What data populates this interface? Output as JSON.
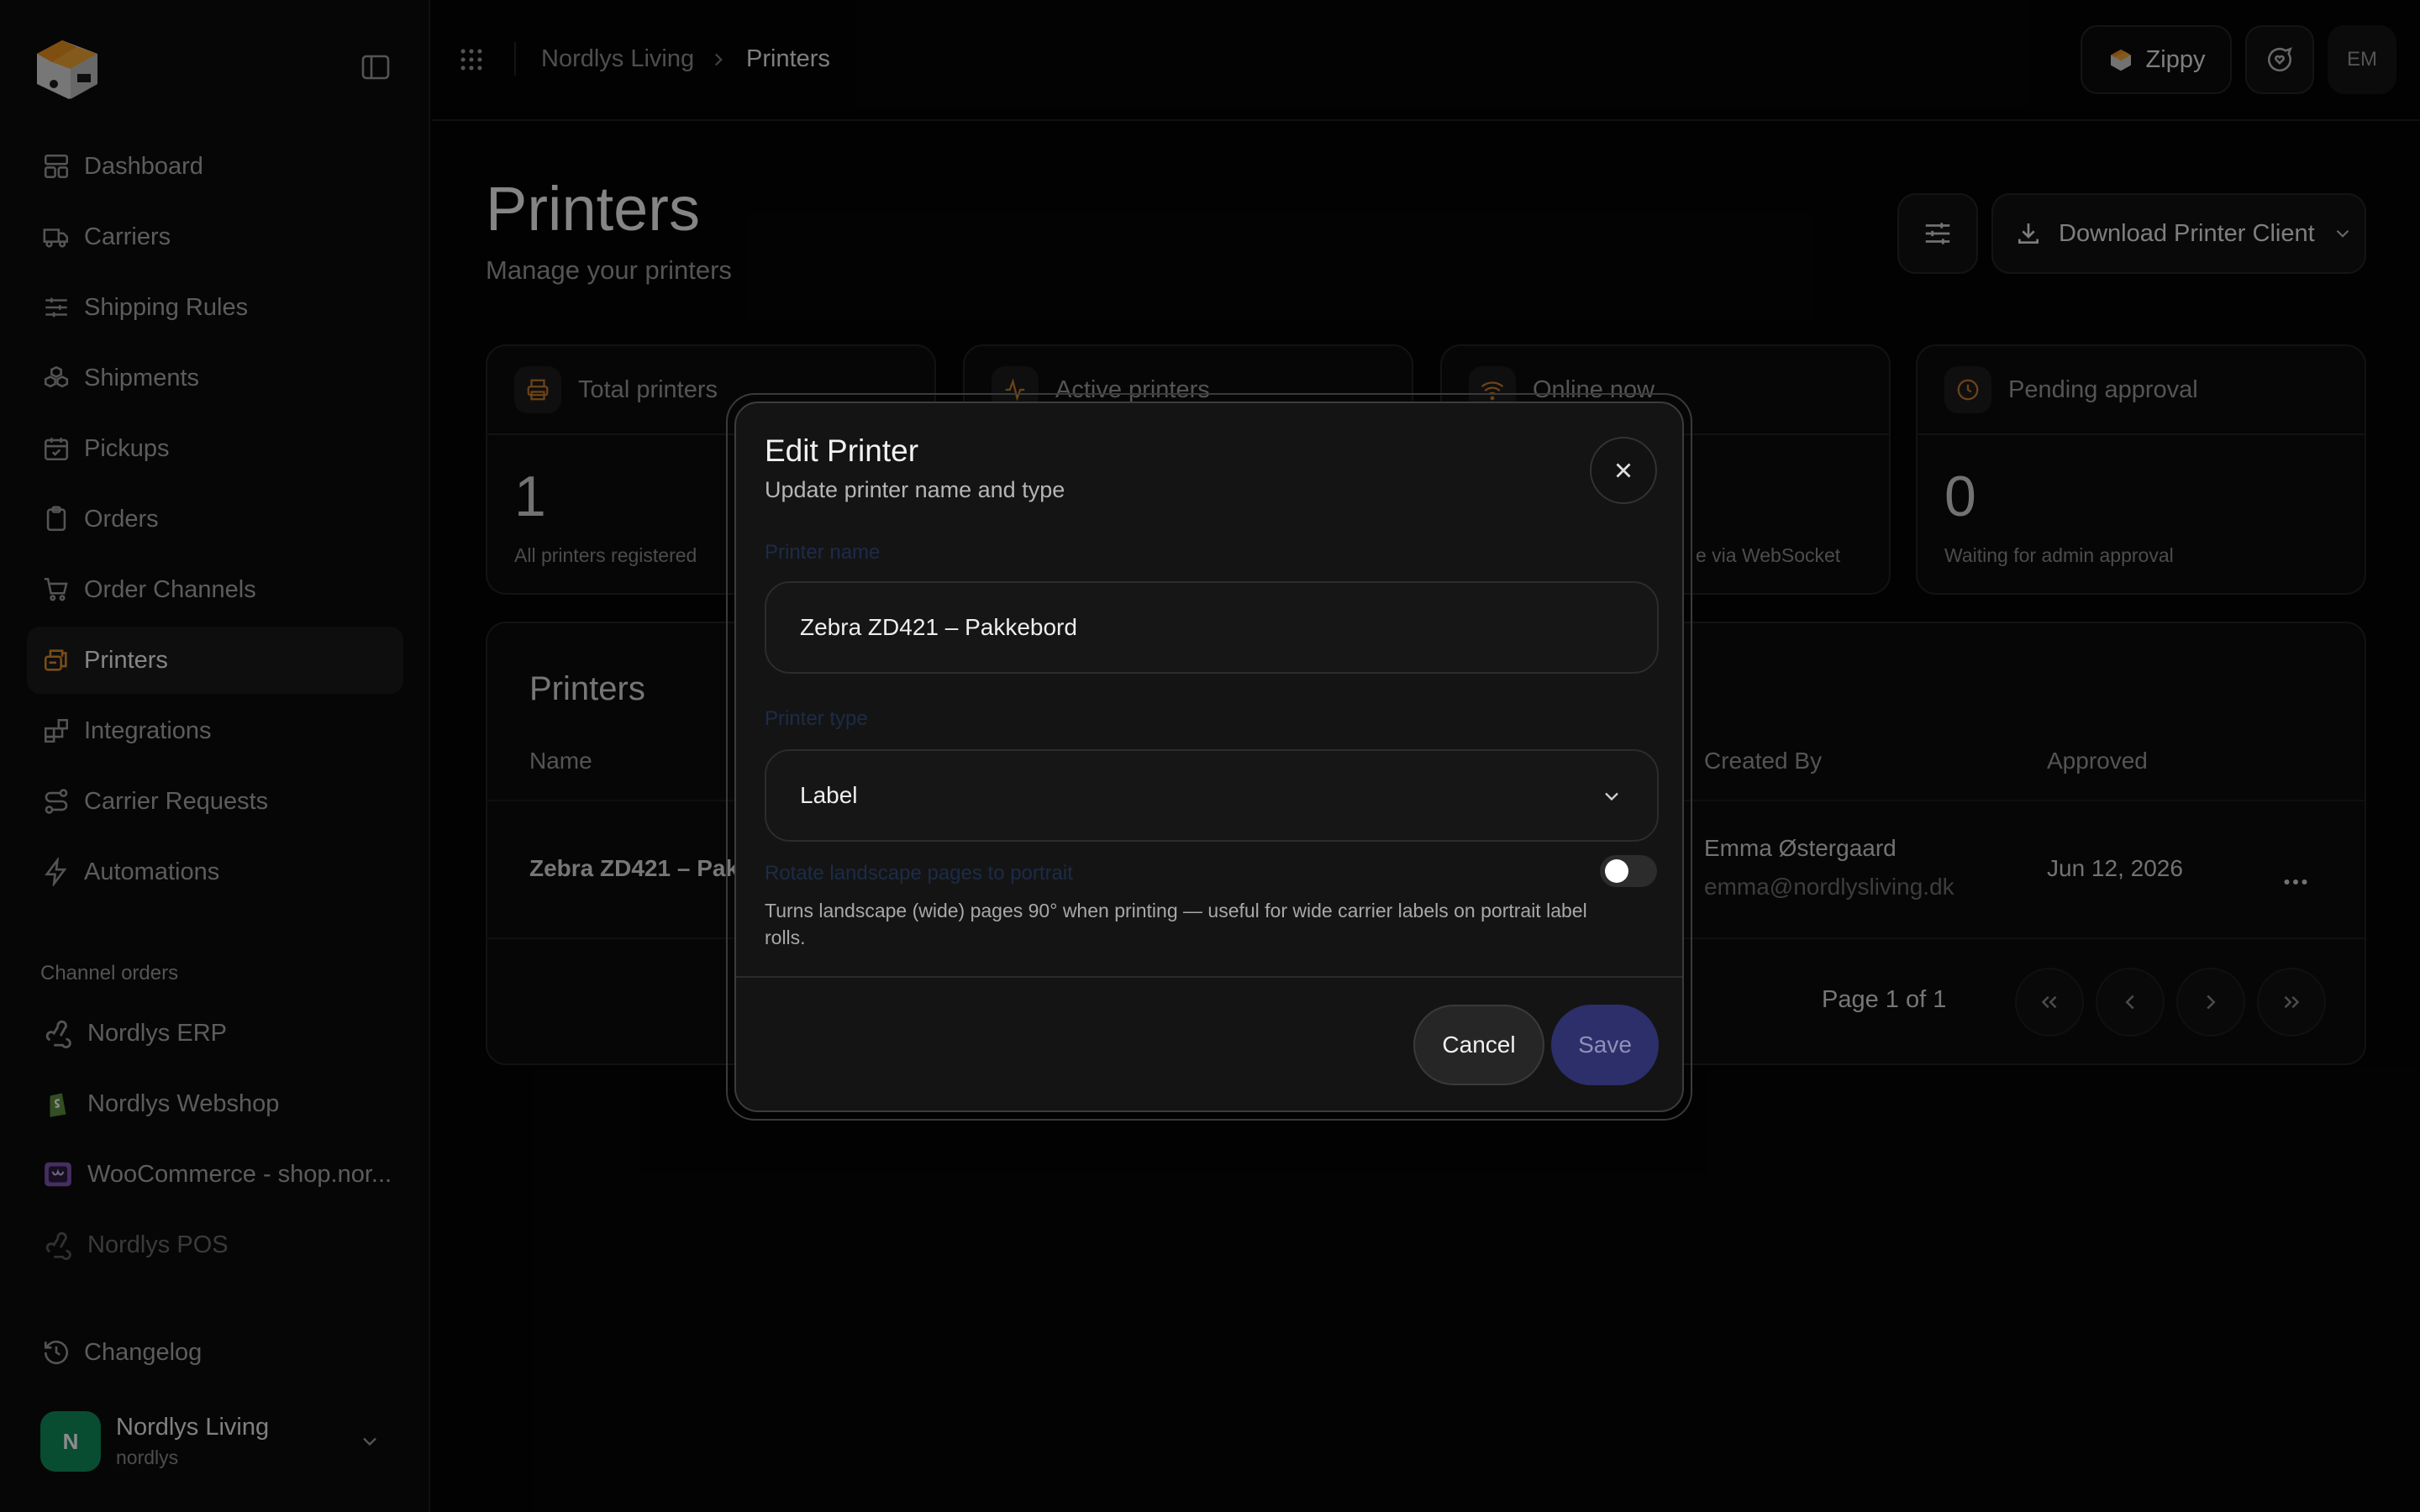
{
  "breadcrumb": {
    "org": "Nordlys Living",
    "current": "Printers"
  },
  "topbar": {
    "zippy_label": "Zippy",
    "user_initials": "EM"
  },
  "sidebar": {
    "items": [
      {
        "label": "Dashboard",
        "icon": "dashboard-icon"
      },
      {
        "label": "Carriers",
        "icon": "truck-icon"
      },
      {
        "label": "Shipping Rules",
        "icon": "sliders-icon"
      },
      {
        "label": "Shipments",
        "icon": "boxes-icon"
      },
      {
        "label": "Pickups",
        "icon": "calendar-check-icon"
      },
      {
        "label": "Orders",
        "icon": "clipboard-icon"
      },
      {
        "label": "Order Channels",
        "icon": "cart-icon"
      },
      {
        "label": "Printers",
        "icon": "printer-icon",
        "active": true
      },
      {
        "label": "Integrations",
        "icon": "blocks-icon"
      },
      {
        "label": "Carrier Requests",
        "icon": "route-icon"
      },
      {
        "label": "Automations",
        "icon": "zap-icon"
      }
    ],
    "channels_title": "Channel orders",
    "channels": [
      {
        "label": "Nordlys ERP",
        "icon": "webhook-icon"
      },
      {
        "label": "Nordlys Webshop",
        "icon": "shopify-icon"
      },
      {
        "label": "WooCommerce - shop.nor...",
        "icon": "woocommerce-icon"
      },
      {
        "label": "Nordlys POS",
        "icon": "webhook-icon"
      }
    ],
    "changelog": "Changelog",
    "account": {
      "initial": "N",
      "name": "Nordlys Living",
      "handle": "nordlys"
    }
  },
  "page": {
    "title": "Printers",
    "subtitle": "Manage your printers",
    "download_label": "Download Printer Client"
  },
  "stats": [
    {
      "label": "Total printers",
      "value": "1",
      "desc": "All printers registered"
    },
    {
      "label": "Active printers",
      "value": "",
      "desc": ""
    },
    {
      "label": "Online now",
      "value": "",
      "desc": "e via WebSocket"
    },
    {
      "label": "Pending approval",
      "value": "0",
      "desc": "Waiting for admin approval"
    }
  ],
  "table": {
    "title": "Printers",
    "columns": {
      "name": "Name",
      "created_by": "Created By",
      "approved": "Approved"
    },
    "rows": [
      {
        "name": "Zebra ZD421 – Pak",
        "created_by": "Emma Østergaard",
        "email": "emma@nordlysliving.dk",
        "approved": "Jun 12, 2026"
      }
    ],
    "pagination": "Page 1 of 1"
  },
  "modal": {
    "title": "Edit Printer",
    "subtitle": "Update printer name and type",
    "name_label": "Printer name",
    "name_value": "Zebra ZD421 – Pakkebord",
    "type_label": "Printer type",
    "type_value": "Label",
    "rotate_label": "Rotate landscape pages to portrait",
    "rotate_enabled": false,
    "rotate_help": "Turns landscape (wide) pages 90° when printing — useful for wide carrier labels on portrait label rolls.",
    "cancel": "Cancel",
    "save": "Save"
  }
}
